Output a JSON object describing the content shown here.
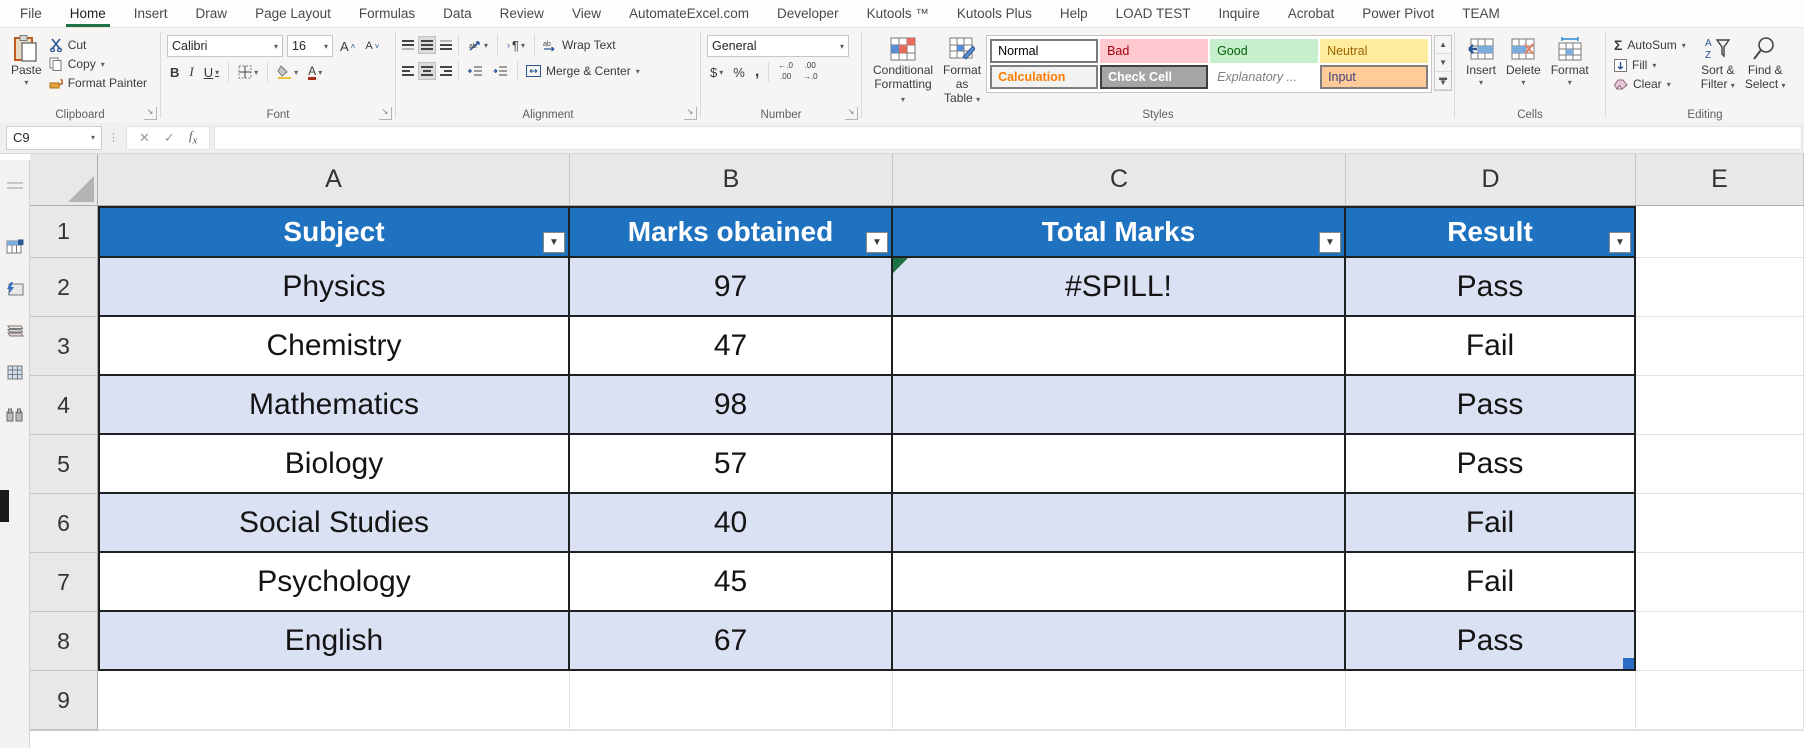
{
  "ribbon": {
    "tabs": [
      "File",
      "Home",
      "Insert",
      "Draw",
      "Page Layout",
      "Formulas",
      "Data",
      "Review",
      "View",
      "AutomateExcel.com",
      "Developer",
      "Kutools ™",
      "Kutools Plus",
      "Help",
      "LOAD TEST",
      "Inquire",
      "Acrobat",
      "Power Pivot",
      "TEAM"
    ],
    "active_tab": "Home",
    "group_labels": [
      "Clipboard",
      "Font",
      "Alignment",
      "Number",
      "Styles",
      "Cells",
      "Editing"
    ],
    "clipboard": {
      "paste": "Paste",
      "cut": "Cut",
      "copy": "Copy",
      "format_painter": "Format Painter"
    },
    "font": {
      "font_name": "Calibri",
      "font_size": "16"
    },
    "alignment": {
      "wrap_text": "Wrap Text",
      "merge_center": "Merge & Center"
    },
    "number": {
      "format": "General",
      "currency": "$",
      "percent": "%",
      "comma": ","
    },
    "styles": {
      "conditional_1": "Conditional",
      "conditional_2": "Formatting",
      "format_as_1": "Format as",
      "format_as_2": "Table",
      "gallery": [
        {
          "label": "Normal",
          "bg": "#ffffff",
          "fg": "#000000",
          "border": "#7a7a7a",
          "bold": false,
          "italic": false
        },
        {
          "label": "Bad",
          "bg": "#ffc7ce",
          "fg": "#9c0006",
          "border": "transparent",
          "bold": false,
          "italic": false
        },
        {
          "label": "Good",
          "bg": "#c6efce",
          "fg": "#006100",
          "border": "transparent",
          "bold": false,
          "italic": false
        },
        {
          "label": "Neutral",
          "bg": "#ffeb9c",
          "fg": "#9c6500",
          "border": "transparent",
          "bold": false,
          "italic": false
        },
        {
          "label": "Calculation",
          "bg": "#f2f2f2",
          "fg": "#fa7d00",
          "border": "#7f7f7f",
          "bold": true,
          "italic": false
        },
        {
          "label": "Check Cell",
          "bg": "#a5a5a5",
          "fg": "#ffffff",
          "border": "#3f3f3f",
          "bold": true,
          "italic": false
        },
        {
          "label": "Explanatory ...",
          "bg": "#ffffff",
          "fg": "#7f7f7f",
          "border": "transparent",
          "bold": false,
          "italic": true
        },
        {
          "label": "Input",
          "bg": "#ffcc99",
          "fg": "#3f3f76",
          "border": "#7f7f7f",
          "bold": false,
          "italic": false
        }
      ]
    },
    "cells": {
      "insert": "Insert",
      "delete": "Delete",
      "format": "Format"
    },
    "editing": {
      "autosum": "AutoSum",
      "fill": "Fill",
      "clear": "Clear",
      "sort_1": "Sort &",
      "sort_2": "Filter",
      "find_1": "Find &",
      "find_2": "Select"
    }
  },
  "formula_bar": {
    "name_box": "C9",
    "formula": ""
  },
  "sheet": {
    "column_letters": [
      "A",
      "B",
      "C",
      "D",
      "E"
    ],
    "row_numbers": [
      "1",
      "2",
      "3",
      "4",
      "5",
      "6",
      "7",
      "8",
      "9"
    ],
    "table": {
      "headers": [
        "Subject",
        "Marks obtained",
        "Total Marks",
        "Result"
      ],
      "rows": [
        {
          "num": "2",
          "shaded": true,
          "cells": [
            "Physics",
            "97",
            "#SPILL!",
            "Pass"
          ],
          "error_marker": "C2"
        },
        {
          "num": "3",
          "shaded": false,
          "cells": [
            "Chemistry",
            "47",
            "",
            "Fail"
          ]
        },
        {
          "num": "4",
          "shaded": true,
          "cells": [
            "Mathematics",
            "98",
            "",
            "Pass"
          ]
        },
        {
          "num": "5",
          "shaded": false,
          "cells": [
            "Biology",
            "57",
            "",
            "Pass"
          ]
        },
        {
          "num": "6",
          "shaded": true,
          "cells": [
            "Social Studies",
            "40",
            "",
            "Fail"
          ]
        },
        {
          "num": "7",
          "shaded": false,
          "cells": [
            "Psychology",
            "45",
            "",
            "Fail"
          ]
        },
        {
          "num": "8",
          "shaded": true,
          "cells": [
            "English",
            "67",
            "",
            "Pass"
          ],
          "resize_handle": true
        },
        {
          "num": "9",
          "shaded": false,
          "cells": [
            "",
            "",
            "",
            ""
          ]
        }
      ]
    }
  },
  "colors": {
    "table_header_blue": "#1e72c0",
    "banded_row": "#d9e1f2",
    "active_tab_green": "#217346",
    "error_triangle_green": "#1e7145",
    "table_border": "#1f2022",
    "resize_handle_blue": "#2b6cc4"
  }
}
